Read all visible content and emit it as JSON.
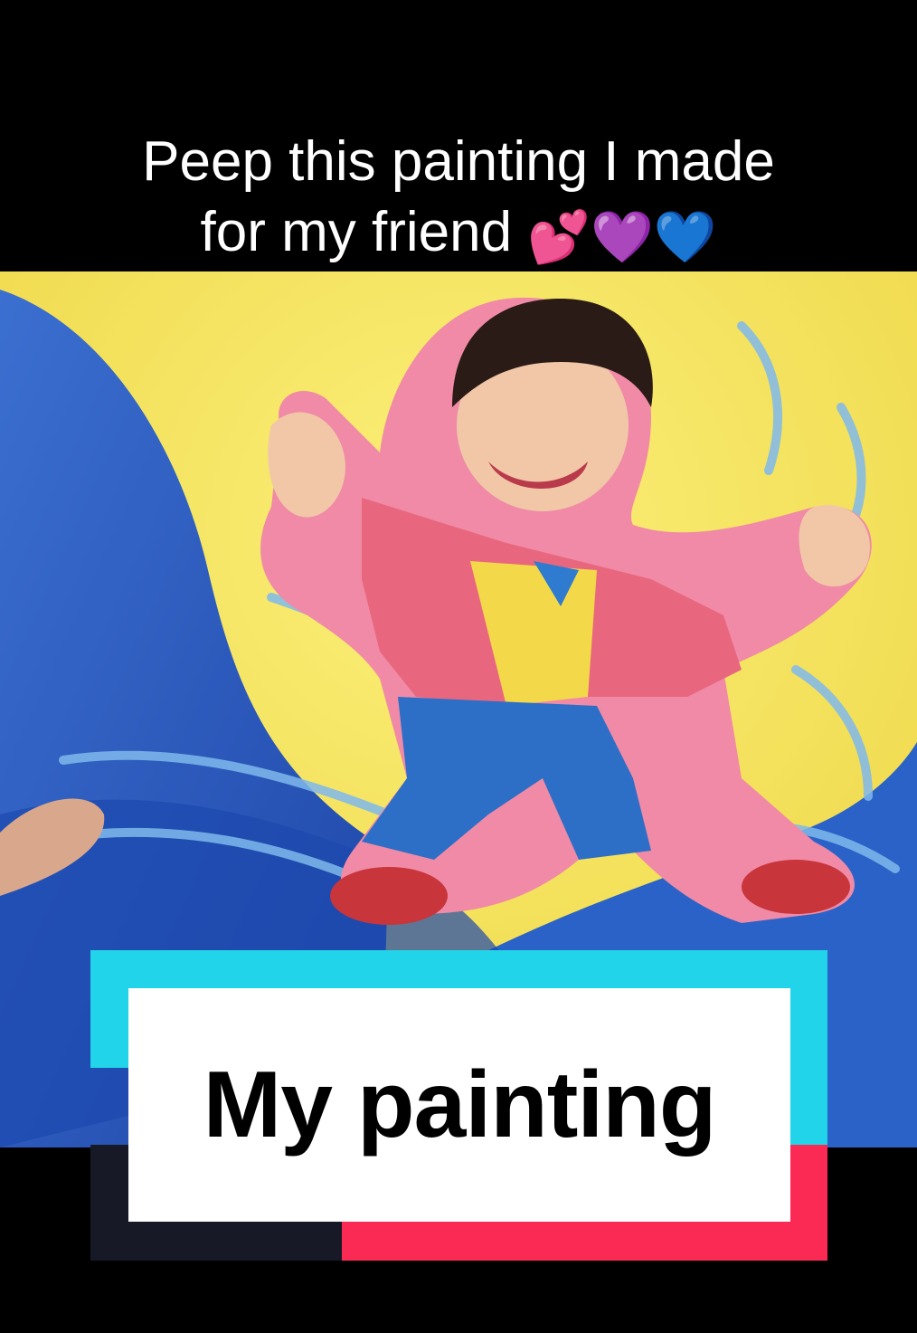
{
  "caption": {
    "line1": "Peep this painting I made",
    "line2": "for my friend",
    "emoji": "💕💜💙"
  },
  "sticker": {
    "label": "My painting",
    "colors": {
      "cyan": "#22d4ea",
      "red": "#fb2a55",
      "dark": "#171a26",
      "card": "#ffffff"
    }
  },
  "painting": {
    "subject": "cartoon boy with arms outstretched in pink jacket over a yellow star shirt and blue jeans",
    "background_colors": [
      "#f4e35a",
      "#2a62c8",
      "#1a3f9e"
    ],
    "outline_color": "#f08aa6"
  }
}
